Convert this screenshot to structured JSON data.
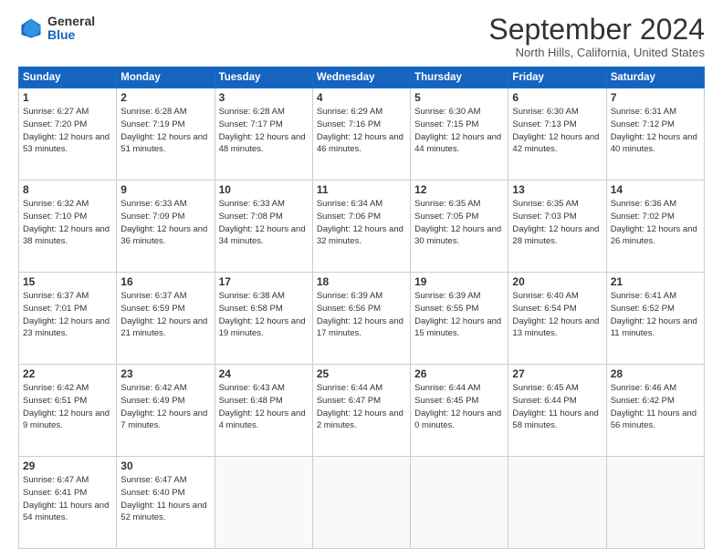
{
  "header": {
    "logo": {
      "general": "General",
      "blue": "Blue"
    },
    "title": "September 2024",
    "location": "North Hills, California, United States"
  },
  "calendar": {
    "weekdays": [
      "Sunday",
      "Monday",
      "Tuesday",
      "Wednesday",
      "Thursday",
      "Friday",
      "Saturday"
    ],
    "weeks": [
      [
        null,
        {
          "day": 2,
          "sunrise": "6:28 AM",
          "sunset": "7:19 PM",
          "daylight": "12 hours and 51 minutes."
        },
        {
          "day": 3,
          "sunrise": "6:28 AM",
          "sunset": "7:17 PM",
          "daylight": "12 hours and 48 minutes."
        },
        {
          "day": 4,
          "sunrise": "6:29 AM",
          "sunset": "7:16 PM",
          "daylight": "12 hours and 46 minutes."
        },
        {
          "day": 5,
          "sunrise": "6:30 AM",
          "sunset": "7:15 PM",
          "daylight": "12 hours and 44 minutes."
        },
        {
          "day": 6,
          "sunrise": "6:30 AM",
          "sunset": "7:13 PM",
          "daylight": "12 hours and 42 minutes."
        },
        {
          "day": 7,
          "sunrise": "6:31 AM",
          "sunset": "7:12 PM",
          "daylight": "12 hours and 40 minutes."
        }
      ],
      [
        {
          "day": 1,
          "sunrise": "6:27 AM",
          "sunset": "7:20 PM",
          "daylight": "12 hours and 53 minutes."
        },
        {
          "day": 2,
          "sunrise": "6:28 AM",
          "sunset": "7:19 PM",
          "daylight": "12 hours and 51 minutes."
        },
        {
          "day": 3,
          "sunrise": "6:28 AM",
          "sunset": "7:17 PM",
          "daylight": "12 hours and 48 minutes."
        },
        {
          "day": 4,
          "sunrise": "6:29 AM",
          "sunset": "7:16 PM",
          "daylight": "12 hours and 46 minutes."
        },
        {
          "day": 5,
          "sunrise": "6:30 AM",
          "sunset": "7:15 PM",
          "daylight": "12 hours and 44 minutes."
        },
        {
          "day": 6,
          "sunrise": "6:30 AM",
          "sunset": "7:13 PM",
          "daylight": "12 hours and 42 minutes."
        },
        {
          "day": 7,
          "sunrise": "6:31 AM",
          "sunset": "7:12 PM",
          "daylight": "12 hours and 40 minutes."
        }
      ],
      [
        {
          "day": 8,
          "sunrise": "6:32 AM",
          "sunset": "7:10 PM",
          "daylight": "12 hours and 38 minutes."
        },
        {
          "day": 9,
          "sunrise": "6:33 AM",
          "sunset": "7:09 PM",
          "daylight": "12 hours and 36 minutes."
        },
        {
          "day": 10,
          "sunrise": "6:33 AM",
          "sunset": "7:08 PM",
          "daylight": "12 hours and 34 minutes."
        },
        {
          "day": 11,
          "sunrise": "6:34 AM",
          "sunset": "7:06 PM",
          "daylight": "12 hours and 32 minutes."
        },
        {
          "day": 12,
          "sunrise": "6:35 AM",
          "sunset": "7:05 PM",
          "daylight": "12 hours and 30 minutes."
        },
        {
          "day": 13,
          "sunrise": "6:35 AM",
          "sunset": "7:03 PM",
          "daylight": "12 hours and 28 minutes."
        },
        {
          "day": 14,
          "sunrise": "6:36 AM",
          "sunset": "7:02 PM",
          "daylight": "12 hours and 26 minutes."
        }
      ],
      [
        {
          "day": 15,
          "sunrise": "6:37 AM",
          "sunset": "7:01 PM",
          "daylight": "12 hours and 23 minutes."
        },
        {
          "day": 16,
          "sunrise": "6:37 AM",
          "sunset": "6:59 PM",
          "daylight": "12 hours and 21 minutes."
        },
        {
          "day": 17,
          "sunrise": "6:38 AM",
          "sunset": "6:58 PM",
          "daylight": "12 hours and 19 minutes."
        },
        {
          "day": 18,
          "sunrise": "6:39 AM",
          "sunset": "6:56 PM",
          "daylight": "12 hours and 17 minutes."
        },
        {
          "day": 19,
          "sunrise": "6:39 AM",
          "sunset": "6:55 PM",
          "daylight": "12 hours and 15 minutes."
        },
        {
          "day": 20,
          "sunrise": "6:40 AM",
          "sunset": "6:54 PM",
          "daylight": "12 hours and 13 minutes."
        },
        {
          "day": 21,
          "sunrise": "6:41 AM",
          "sunset": "6:52 PM",
          "daylight": "12 hours and 11 minutes."
        }
      ],
      [
        {
          "day": 22,
          "sunrise": "6:42 AM",
          "sunset": "6:51 PM",
          "daylight": "12 hours and 9 minutes."
        },
        {
          "day": 23,
          "sunrise": "6:42 AM",
          "sunset": "6:49 PM",
          "daylight": "12 hours and 7 minutes."
        },
        {
          "day": 24,
          "sunrise": "6:43 AM",
          "sunset": "6:48 PM",
          "daylight": "12 hours and 4 minutes."
        },
        {
          "day": 25,
          "sunrise": "6:44 AM",
          "sunset": "6:47 PM",
          "daylight": "12 hours and 2 minutes."
        },
        {
          "day": 26,
          "sunrise": "6:44 AM",
          "sunset": "6:45 PM",
          "daylight": "12 hours and 0 minutes."
        },
        {
          "day": 27,
          "sunrise": "6:45 AM",
          "sunset": "6:44 PM",
          "daylight": "11 hours and 58 minutes."
        },
        {
          "day": 28,
          "sunrise": "6:46 AM",
          "sunset": "6:42 PM",
          "daylight": "11 hours and 56 minutes."
        }
      ],
      [
        {
          "day": 29,
          "sunrise": "6:47 AM",
          "sunset": "6:41 PM",
          "daylight": "11 hours and 54 minutes."
        },
        {
          "day": 30,
          "sunrise": "6:47 AM",
          "sunset": "6:40 PM",
          "daylight": "11 hours and 52 minutes."
        },
        null,
        null,
        null,
        null,
        null
      ]
    ]
  }
}
